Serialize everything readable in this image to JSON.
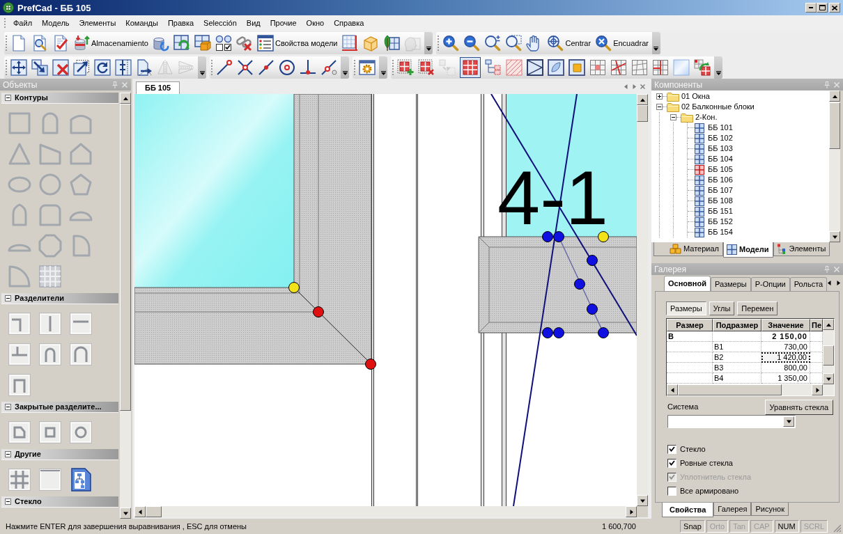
{
  "window": {
    "title": "PrefCad - ББ 105"
  },
  "menu": [
    "Файл",
    "Модель",
    "Элементы",
    "Команды",
    "Правка",
    "Selección",
    "Вид",
    "Прочие",
    "Окно",
    "Справка"
  ],
  "toolbar_rows": [
    {
      "groups": [
        {
          "items": [
            {
              "disabled": false
            },
            {
              "disabled": false
            },
            {
              "disabled": false
            },
            {
              "label": "Almacenamiento",
              "disabled": false
            },
            {
              "disabled": false
            },
            {
              "disabled": false
            },
            {
              "disabled": false
            },
            {
              "disabled": false
            },
            {
              "disabled": false
            },
            {
              "label": "Свойства модели",
              "disabled": false
            },
            {
              "disabled": false
            },
            {
              "disabled": false
            },
            {
              "disabled": false
            },
            {
              "disabled": true
            }
          ]
        },
        {
          "items": [
            {
              "disabled": false
            },
            {
              "disabled": false
            },
            {
              "disabled": false
            },
            {
              "disabled": false
            },
            {
              "disabled": false
            },
            {
              "label": "Centrar",
              "disabled": false
            },
            {
              "label": "Encuadrar",
              "disabled": false
            }
          ]
        }
      ]
    },
    {
      "groups": [
        {
          "items": [
            {
              "disabled": false
            },
            {
              "disabled": false
            },
            {
              "disabled": false
            },
            {
              "disabled": false
            },
            {
              "disabled": false
            },
            {
              "disabled": false
            },
            {
              "disabled": false
            },
            {
              "disabled": true
            },
            {
              "disabled": true
            }
          ]
        },
        {
          "items": [
            {
              "disabled": false
            },
            {
              "disabled": false
            },
            {
              "disabled": false
            },
            {
              "disabled": false
            },
            {
              "disabled": false
            },
            {
              "disabled": false
            }
          ]
        },
        {
          "items": [
            {
              "disabled": false
            }
          ]
        },
        {
          "items": [
            {
              "disabled": false,
              "selected": false
            },
            {
              "disabled": false,
              "selected": false
            },
            {
              "disabled": true,
              "selected": false
            },
            {
              "disabled": false,
              "selected": true
            },
            {
              "disabled": false,
              "selected": false
            },
            {
              "disabled": false,
              "selected": false
            },
            {
              "disabled": false,
              "selected": false
            },
            {
              "disabled": false,
              "selected": false
            },
            {
              "disabled": false,
              "selected": false
            },
            {
              "disabled": false,
              "selected": false
            },
            {
              "disabled": false,
              "selected": false
            },
            {
              "disabled": false,
              "selected": false
            },
            {
              "disabled": false,
              "selected": false
            },
            {
              "disabled": false,
              "selected": false
            },
            {
              "disabled": false,
              "selected": false
            }
          ]
        }
      ]
    }
  ],
  "objects_panel": {
    "title": "Объекты",
    "sections": [
      {
        "title": "Контуры",
        "expanded": true
      },
      {
        "title": "Разделители",
        "expanded": true
      },
      {
        "title": "Закрытые разделите...",
        "expanded": true
      },
      {
        "title": "Другие",
        "expanded": true
      },
      {
        "title": "Стекло",
        "expanded": true
      }
    ]
  },
  "document_tabs": [
    {
      "label": "ББ 105",
      "selected": true
    }
  ],
  "canvas": {
    "dimension_label": "4-1"
  },
  "components_panel": {
    "title": "Компоненты",
    "tree": [
      {
        "kind": "folder",
        "label": "01 Окна",
        "expanded": false
      },
      {
        "kind": "folder",
        "label": "02 Балконные блоки",
        "expanded": true,
        "children": [
          {
            "kind": "folder",
            "label": "2-Кон.",
            "expanded": true,
            "children": [
              {
                "kind": "model",
                "label": "ББ 101",
                "current": false
              },
              {
                "kind": "model",
                "label": "ББ 102",
                "current": false
              },
              {
                "kind": "model",
                "label": "ББ 103",
                "current": false
              },
              {
                "kind": "model",
                "label": "ББ 104",
                "current": false
              },
              {
                "kind": "model",
                "label": "ББ 105",
                "current": true
              },
              {
                "kind": "model",
                "label": "ББ 106",
                "current": false
              },
              {
                "kind": "model",
                "label": "ББ 107",
                "current": false
              },
              {
                "kind": "model",
                "label": "ББ 108",
                "current": false
              },
              {
                "kind": "model",
                "label": "ББ 151",
                "current": false
              },
              {
                "kind": "model",
                "label": "ББ 152",
                "current": false
              },
              {
                "kind": "model",
                "label": "ББ 154",
                "current": false
              }
            ]
          }
        ]
      }
    ],
    "tabs": [
      {
        "label": "Материал",
        "selected": false
      },
      {
        "label": "Модели",
        "selected": true
      },
      {
        "label": "Элементы",
        "selected": false
      }
    ]
  },
  "gallery_panel": {
    "title": "Галерея",
    "tabs": [
      {
        "label": "Основной",
        "selected": true
      },
      {
        "label": "Размеры",
        "selected": false
      },
      {
        "label": "Р-Опции",
        "selected": false
      },
      {
        "label": "Рольста",
        "selected": false
      }
    ],
    "sub_tabs": [
      {
        "label": "Размеры",
        "selected": true
      },
      {
        "label": "Углы",
        "selected": false
      },
      {
        "label": "Перемен",
        "selected": false
      }
    ],
    "table": {
      "columns": [
        "Размер",
        "Подразмер",
        "Значение",
        "Пе"
      ],
      "rows": [
        {
          "kind": "group",
          "size": "B",
          "value": "2 150,00",
          "selected": false
        },
        {
          "kind": "item",
          "subsize": "B1",
          "value": "730,00",
          "selected": false
        },
        {
          "kind": "item",
          "subsize": "B2",
          "value": "1 420,00",
          "selected": true
        },
        {
          "kind": "item",
          "subsize": "B3",
          "value": "800,00",
          "selected": false
        },
        {
          "kind": "item",
          "subsize": "B4",
          "value": "1 350,00",
          "selected": false
        }
      ]
    },
    "system": {
      "label": "Система"
    },
    "equalize_button": "Уравнять стекла",
    "checkboxes": [
      {
        "label": "Стекло",
        "checked": true,
        "disabled": false
      },
      {
        "label": "Ровные стекла",
        "checked": true,
        "disabled": false
      },
      {
        "label": "Уплотнитель стекла",
        "checked": true,
        "disabled": true
      },
      {
        "label": "Все армировано",
        "checked": false,
        "disabled": false
      }
    ],
    "bottom_tabs": [
      {
        "label": "Свойства",
        "selected": true
      },
      {
        "label": "Галерея",
        "selected": false
      },
      {
        "label": "Рисунок",
        "selected": false
      }
    ]
  },
  "status_bar": {
    "message": "Нажмите ENTER для завершения выравнивания , ESC для отмены",
    "coordinates": "1 600,700",
    "indicators": [
      {
        "label": "Snap",
        "on": true
      },
      {
        "label": "Orto",
        "on": false
      },
      {
        "label": "Tan",
        "on": false
      },
      {
        "label": "CAP",
        "on": false
      },
      {
        "label": "NUM",
        "on": true
      },
      {
        "label": "SCRL",
        "on": false
      }
    ]
  }
}
